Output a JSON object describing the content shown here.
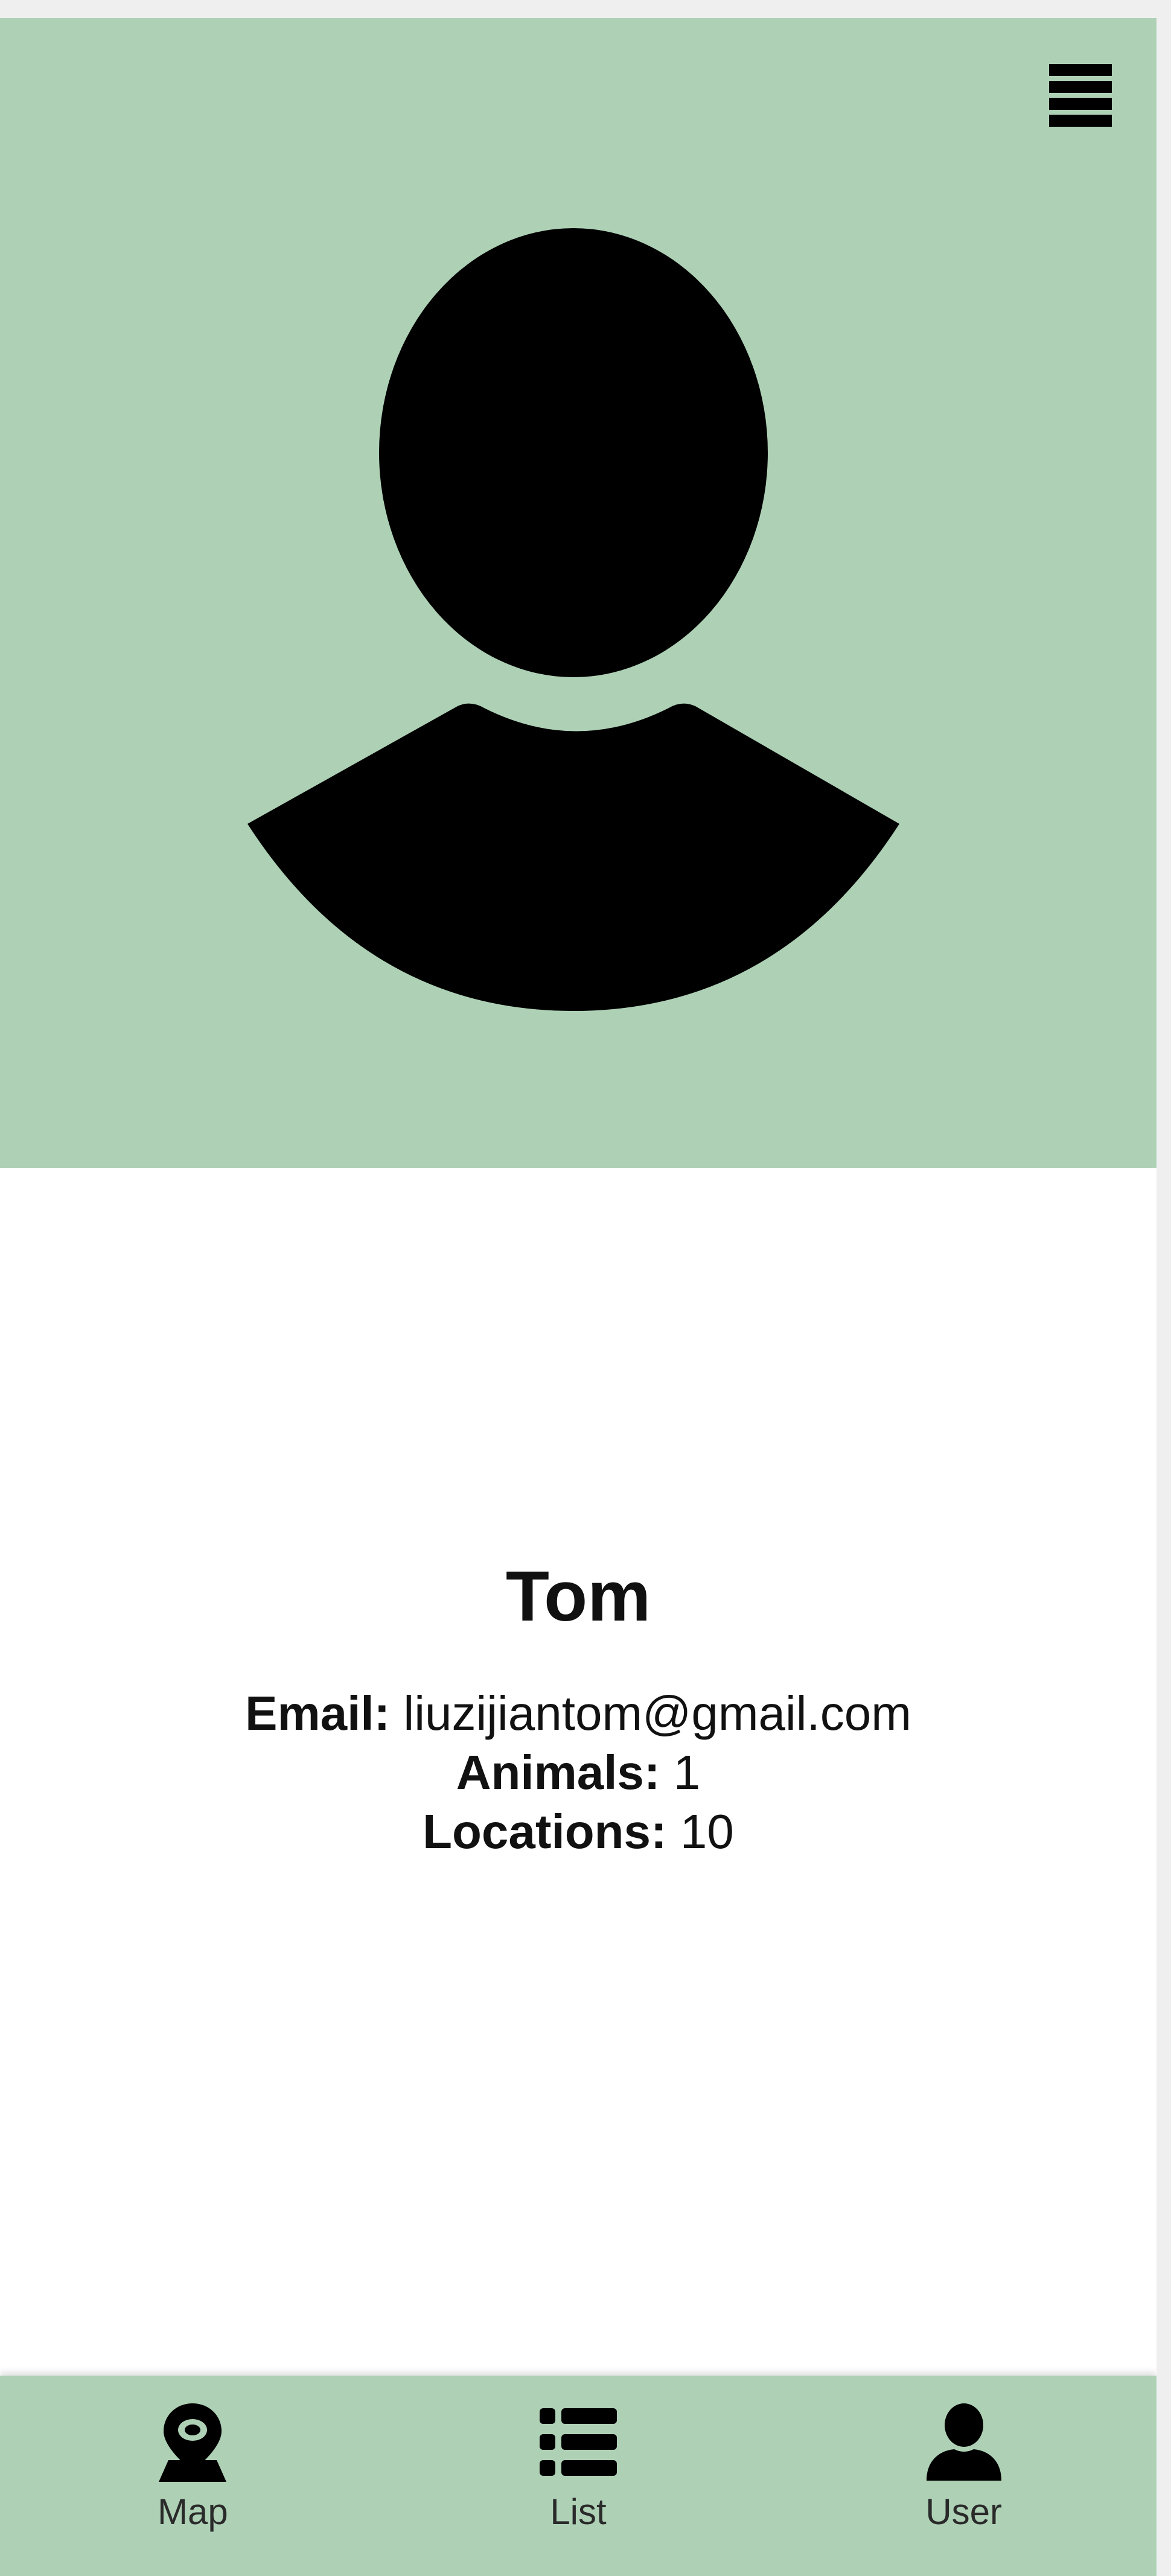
{
  "header": {
    "menu_icon": "hamburger-menu-icon",
    "avatar_icon": "user-silhouette-icon",
    "background_color": "#aed1b6"
  },
  "profile": {
    "name": "Tom",
    "email_label": "Email:",
    "email_value": "liuzijiantom@gmail.com",
    "animals_label": "Animals:",
    "animals_value": "1",
    "locations_label": "Locations:",
    "locations_value": "10"
  },
  "bottom_nav": {
    "items": [
      {
        "label": "Map",
        "icon": "map-pin-icon"
      },
      {
        "label": "List",
        "icon": "list-icon"
      },
      {
        "label": "User",
        "icon": "user-icon"
      }
    ]
  }
}
